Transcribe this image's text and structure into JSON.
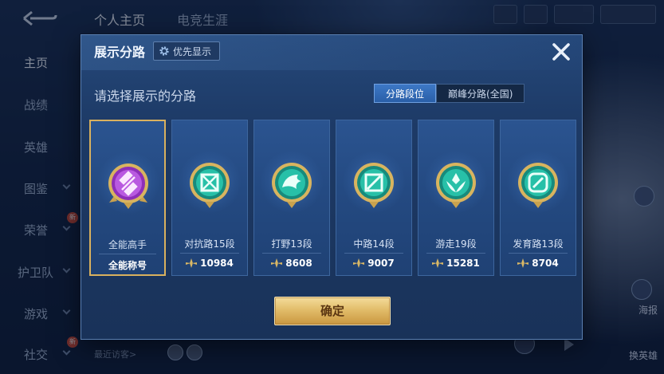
{
  "background": {
    "top_tabs": [
      "个人主页",
      "电竞生涯"
    ],
    "sidebar": [
      {
        "label": "主页",
        "active": true
      },
      {
        "label": "战绩"
      },
      {
        "label": "英雄"
      },
      {
        "label": "图鉴"
      },
      {
        "label": "荣誉"
      },
      {
        "label": "护卫队"
      },
      {
        "label": "游戏"
      },
      {
        "label": "社交"
      }
    ],
    "recent_visitors": "最近访客>",
    "right_labels": [
      "海报",
      "换英雄"
    ]
  },
  "modal": {
    "title": "展示分路",
    "priority_button": "优先显示",
    "prompt": "请选择展示的分路",
    "tabs": [
      {
        "label": "分路段位",
        "active": true
      },
      {
        "label": "巅峰分路(全国)",
        "active": false
      }
    ],
    "cards": [
      {
        "name": "全能高手",
        "value": "全能称号",
        "selected": true,
        "badge_color": "#a63ccf",
        "icon": "allround-icon"
      },
      {
        "name": "对抗路15段",
        "value": "10984",
        "selected": false,
        "badge_color": "#1fae9b",
        "icon": "sword-cross-icon"
      },
      {
        "name": "打野13段",
        "value": "8608",
        "selected": false,
        "badge_color": "#1fae9b",
        "icon": "beast-icon"
      },
      {
        "name": "中路14段",
        "value": "9007",
        "selected": false,
        "badge_color": "#1fae9b",
        "icon": "slash-icon"
      },
      {
        "name": "游走19段",
        "value": "15281",
        "selected": false,
        "badge_color": "#1fae9b",
        "icon": "wings-icon"
      },
      {
        "name": "发育路13段",
        "value": "8704",
        "selected": false,
        "badge_color": "#1fae9b",
        "icon": "ring-icon"
      }
    ],
    "confirm_label": "确定"
  },
  "colors": {
    "selected_border": "#d9b15e",
    "confirm_gold": "#e2bd6a",
    "tab_active": "#2f67b3"
  }
}
